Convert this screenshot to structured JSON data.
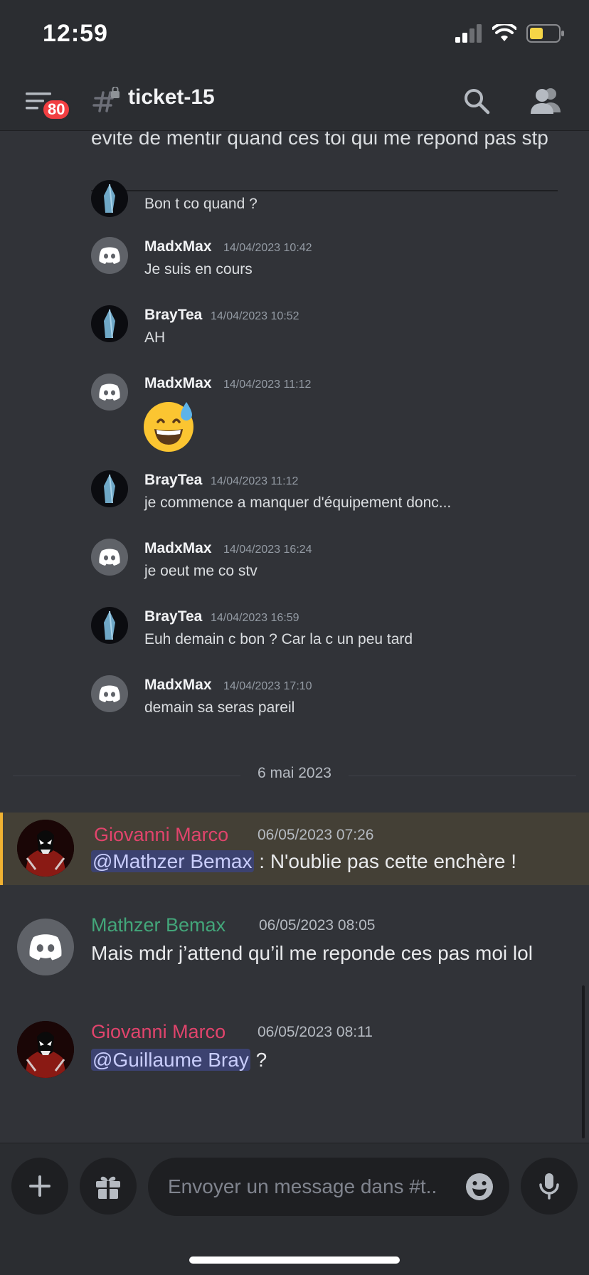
{
  "status_bar": {
    "time": "12:59"
  },
  "header": {
    "badge_count": "80",
    "channel_name": "ticket-15"
  },
  "quoted_message": {
    "text": "evite de mentir quand ces toi qui me repond pas stp"
  },
  "messages": [
    {
      "author": "",
      "timestamp": "",
      "text": "Bon t co quand ?"
    },
    {
      "author": "MadxMax",
      "timestamp": "14/04/2023 10:42",
      "text": "Je suis en cours"
    },
    {
      "author": "BrayTea",
      "timestamp": "14/04/2023 10:52",
      "text": "AH"
    },
    {
      "author": "MadxMax",
      "timestamp": "14/04/2023 11:12",
      "text": ""
    },
    {
      "author": "BrayTea",
      "timestamp": "14/04/2023 11:12",
      "text": "je commence a manquer d'équipement donc..."
    },
    {
      "author": "MadxMax",
      "timestamp": "14/04/2023 16:24",
      "text": "je oeut me co stv"
    },
    {
      "author": "BrayTea",
      "timestamp": "14/04/2023 16:59",
      "text": "Euh demain c bon ? Car la c un peu tard"
    },
    {
      "author": "MadxMax",
      "timestamp": "14/04/2023 17:10",
      "text": "demain sa seras pareil"
    }
  ],
  "date_divider": "6 mai 2023",
  "recent_messages": [
    {
      "author": "Giovanni Marco",
      "timestamp": "06/05/2023 07:26",
      "mention": "@Mathzer Bemax",
      "text": " : N'oublie pas cette enchère !",
      "color": "#e1446c"
    },
    {
      "author": "Mathzer Bemax",
      "timestamp": "06/05/2023 08:05",
      "mention": "",
      "text": "Mais mdr j’attend qu’il me reponde ces pas moi lol",
      "color": "#43a67a"
    },
    {
      "author": "Giovanni Marco",
      "timestamp": "06/05/2023 08:11",
      "mention": "@Guillaume Bray",
      "text": " ?",
      "color": "#e1446c"
    }
  ],
  "composer": {
    "placeholder": "Envoyer un message dans #t.."
  },
  "icons": {
    "menu": "hamburger-icon",
    "channel": "locked-hash-icon",
    "search": "search-icon",
    "members": "members-icon",
    "add": "plus-icon",
    "gift": "gift-icon",
    "emoji": "smiley-icon",
    "mic": "microphone-icon"
  },
  "colors": {
    "accent_red": "#f23f42",
    "highlight_bar": "#f0b232",
    "mention_bg": "#3c4270"
  }
}
